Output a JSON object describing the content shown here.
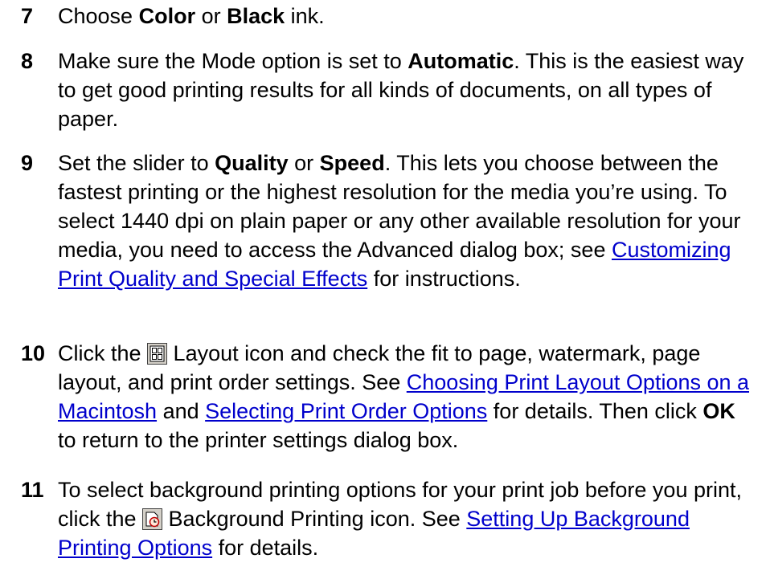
{
  "steps": [
    {
      "number": "7",
      "parts": [
        {
          "t": "text",
          "v": "Choose "
        },
        {
          "t": "bold",
          "v": "Color"
        },
        {
          "t": "text",
          "v": " or "
        },
        {
          "t": "bold",
          "v": "Black"
        },
        {
          "t": "text",
          "v": " ink."
        }
      ]
    },
    {
      "number": "8",
      "parts": [
        {
          "t": "text",
          "v": "Make sure the Mode option is set to "
        },
        {
          "t": "bold",
          "v": "Automatic"
        },
        {
          "t": "text",
          "v": ". This is the easiest way to get good printing results for all kinds of documents, on all types of paper."
        }
      ]
    },
    {
      "number": "9",
      "parts": [
        {
          "t": "text",
          "v": "Set the slider to "
        },
        {
          "t": "bold",
          "v": "Quality"
        },
        {
          "t": "text",
          "v": " or "
        },
        {
          "t": "bold",
          "v": "Speed"
        },
        {
          "t": "text",
          "v": ". This lets you choose between the fastest printing or the highest resolution for the media you’re using. To select 1440 dpi on plain paper or any other available resolution for your media, you need to access the Advanced dialog box; see "
        },
        {
          "t": "link",
          "v": "Customizing Print Quality and Special Effects"
        },
        {
          "t": "text",
          "v": " for instructions."
        }
      ]
    },
    {
      "number": "10",
      "parts": [
        {
          "t": "text",
          "v": "Click the "
        },
        {
          "t": "icon",
          "v": "layout-icon"
        },
        {
          "t": "text",
          "v": " Layout icon and check the fit to page, watermark, page layout, and print order settings. See "
        },
        {
          "t": "link",
          "v": "Choosing Print Layout Options on a Macintosh"
        },
        {
          "t": "text",
          "v": " and "
        },
        {
          "t": "link",
          "v": "Selecting Print Order Options"
        },
        {
          "t": "text",
          "v": " for details. Then click "
        },
        {
          "t": "bold",
          "v": "OK"
        },
        {
          "t": "text",
          "v": " to return to the printer settings dialog box."
        }
      ]
    },
    {
      "number": "11",
      "parts": [
        {
          "t": "text",
          "v": "To select background printing options for your print job before you print, click the "
        },
        {
          "t": "icon",
          "v": "background-printing-icon"
        },
        {
          "t": "text",
          "v": " Background Printing icon. See "
        },
        {
          "t": "link",
          "v": "Setting Up Background Printing Options"
        },
        {
          "t": "text",
          "v": " for details."
        }
      ]
    }
  ],
  "colors": {
    "link": "#0000cc",
    "text": "#000000"
  }
}
